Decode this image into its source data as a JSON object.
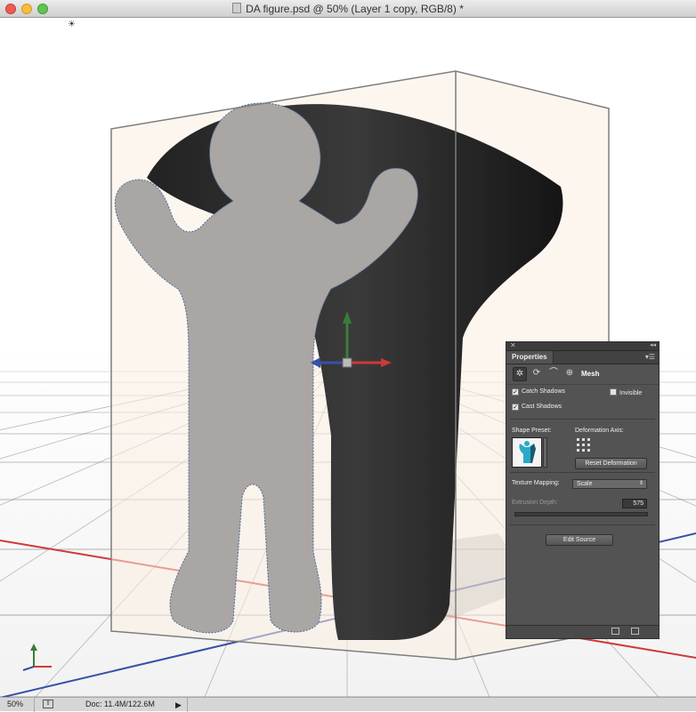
{
  "window": {
    "title": "DA figure.psd @ 50% (Layer 1 copy, RGB/8) *"
  },
  "status": {
    "zoom": "50%",
    "doc": "Doc: 11.4M/122.6M"
  },
  "colors": {
    "x_axis": "#d03838",
    "y_axis": "#3a7d3a",
    "z_axis": "#3850a8",
    "panel_bg": "#535353"
  },
  "properties_panel": {
    "tab_label": "Properties",
    "mode_label": "Mesh",
    "icons": [
      "mesh-properties-icon",
      "deform-icon",
      "cap-icon",
      "coordinates-icon"
    ],
    "catch_shadows_label": "Catch Shadows",
    "catch_shadows_checked": true,
    "invisible_label": "Invisible",
    "invisible_checked": false,
    "cast_shadows_label": "Cast Shadows",
    "cast_shadows_checked": true,
    "shape_preset_label": "Shape Preset:",
    "deformation_axis_label": "Deformation Axis:",
    "reset_deformation_label": "Reset Deformation",
    "texture_mapping_label": "Texture Mapping:",
    "texture_mapping_value": "Scale",
    "extrusion_depth_label": "Extrusion Depth:",
    "extrusion_depth_value": "575",
    "edit_source_label": "Edit Source"
  }
}
